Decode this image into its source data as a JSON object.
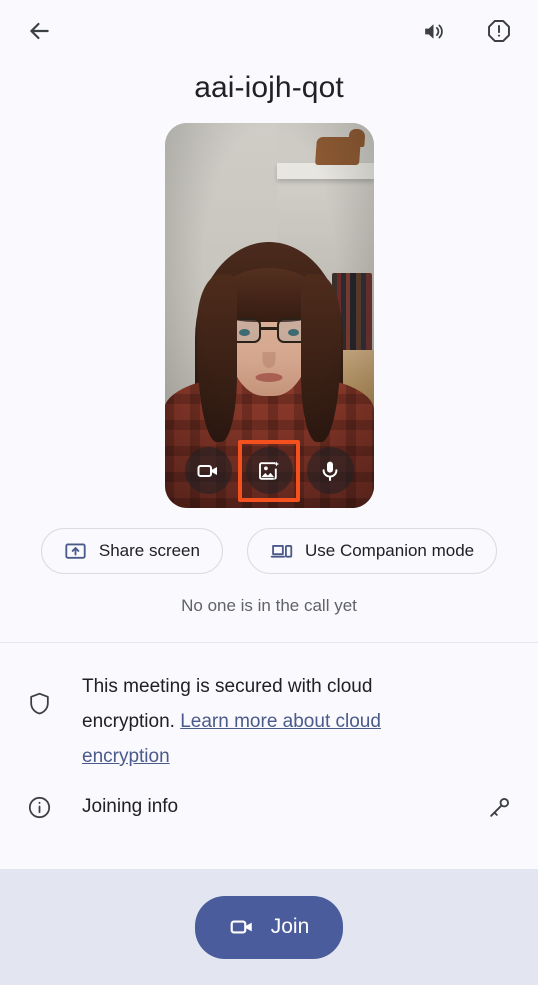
{
  "appbar": {
    "back_label": "Back",
    "speaker_label": "Speaker",
    "report_label": "Report a problem"
  },
  "meeting": {
    "code": "aai-iojh-qot"
  },
  "preview": {
    "camera_label": "Turn off camera",
    "effects_label": "Apply visual effects",
    "mic_label": "Turn off microphone",
    "highlight_color": "#f4511e"
  },
  "actions": {
    "share_screen": "Share screen",
    "companion_mode": "Use Companion mode"
  },
  "status": {
    "text": "No one is in the call yet"
  },
  "info": {
    "encryption": {
      "text_before": "This meeting is secured with cloud encryption. ",
      "link_text": "Learn more about cloud encryption"
    },
    "joining": {
      "text": "Joining info"
    }
  },
  "bottom": {
    "join_label": "Join",
    "join_color": "#4b5c9c",
    "bar_color": "#e3e6f0"
  }
}
